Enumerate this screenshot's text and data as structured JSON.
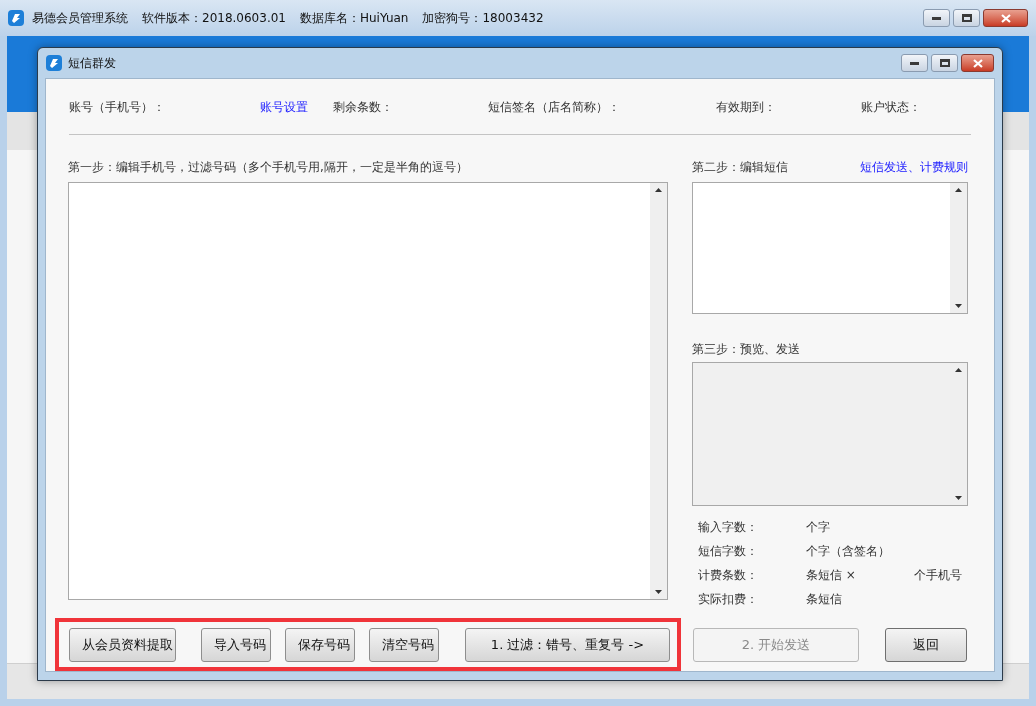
{
  "main_window": {
    "title_parts": [
      "易德会员管理系统",
      "软件版本：2018.0603.01",
      "数据库名：HuiYuan",
      "加密狗号：18003432"
    ]
  },
  "dialog": {
    "title": "短信群发",
    "info_fields": [
      {
        "kind": "text",
        "label": "账号（手机号）："
      },
      {
        "kind": "link",
        "label": "账号设置"
      },
      {
        "kind": "text",
        "label": "剩余条数："
      },
      {
        "kind": "text",
        "label": "短信签名（店名简称）："
      },
      {
        "kind": "text",
        "label": "有效期到："
      },
      {
        "kind": "text",
        "label": "账户状态："
      }
    ],
    "step1": {
      "label": "第一步：编辑手机号，过滤号码（多个手机号用,隔开，一定是半角的逗号）"
    },
    "step2": {
      "label": "第二步：编辑短信",
      "link": "短信发送、计费规则"
    },
    "step3": {
      "label": "第三步：预览、发送"
    },
    "stats": [
      {
        "label": "输入字数：",
        "unit": "个字"
      },
      {
        "label": "短信字数：",
        "unit": "个字（含签名）"
      },
      {
        "label": "计费条数：",
        "unit": "条短信 ×",
        "extra": "个手机号"
      },
      {
        "label": "实际扣费：",
        "unit": "条短信"
      }
    ],
    "left_buttons": [
      {
        "label": "从会员资料提取"
      },
      {
        "label": "导入号码"
      },
      {
        "label": "保存号码"
      },
      {
        "label": "清空号码"
      },
      {
        "label": "1. 过滤：错号、重复号 ->"
      }
    ],
    "right_buttons": [
      {
        "label": "2. 开始发送",
        "disabled": true
      },
      {
        "label": "返回",
        "disabled": false
      }
    ]
  }
}
